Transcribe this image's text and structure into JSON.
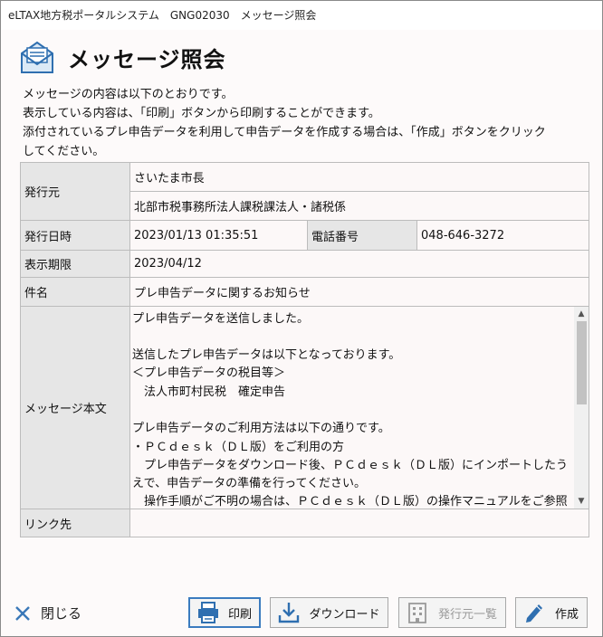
{
  "window": {
    "title": "eLTAX地方税ポータルシステム　GNG02030　メッセージ照会"
  },
  "header": {
    "title": "メッセージ照会"
  },
  "intro": {
    "line1": "メッセージの内容は以下のとおりです。",
    "line2": "表示している内容は、「印刷」ボタンから印刷することができます。",
    "line3": "添付されているプレ申告データを利用して申告データを作成する場合は、「作成」ボタンをクリック",
    "line4": "してください。"
  },
  "table": {
    "issuer_label": "発行元",
    "issuer_city": "さいたま市長",
    "issuer_dept": "北部市税事務所法人課税課法人・諸税係",
    "date_label": "発行日時",
    "date_value": "2023/01/13 01:35:51",
    "phone_label": "電話番号",
    "phone_value": "048-646-3272",
    "expiry_label": "表示期限",
    "expiry_value": "2023/04/12",
    "subject_label": "件名",
    "subject_value": "プレ申告データに関するお知らせ",
    "body_label": "メッセージ本文",
    "body_lines": [
      "プレ申告データを送信しました。",
      "",
      "送信したプレ申告データは以下となっております。",
      "＜プレ申告データの税目等＞",
      "　法人市町村民税　確定申告",
      "",
      "プレ申告データのご利用方法は以下の通りです。",
      "・ＰＣｄｅｓｋ（ＤＬ版）をご利用の方",
      "　プレ申告データをダウンロード後、ＰＣｄｅｓｋ（ＤＬ版）にインポートしたう",
      "えで、申告データの準備を行ってください。",
      "　操作手順がご不明の場合は、ＰＣｄｅｓｋ（ＤＬ版）の操作マニュアルをご参照"
    ],
    "link_label": "リンク先",
    "link_value": ""
  },
  "footer": {
    "close_label": "閉じる",
    "print_label": "印刷",
    "download_label": "ダウンロード",
    "issuer_list_label": "発行元一覧",
    "create_label": "作成"
  },
  "colors": {
    "accent": "#3b7bbf",
    "icon_blue": "#2f6fb0",
    "close_x": "#3a78b8"
  }
}
